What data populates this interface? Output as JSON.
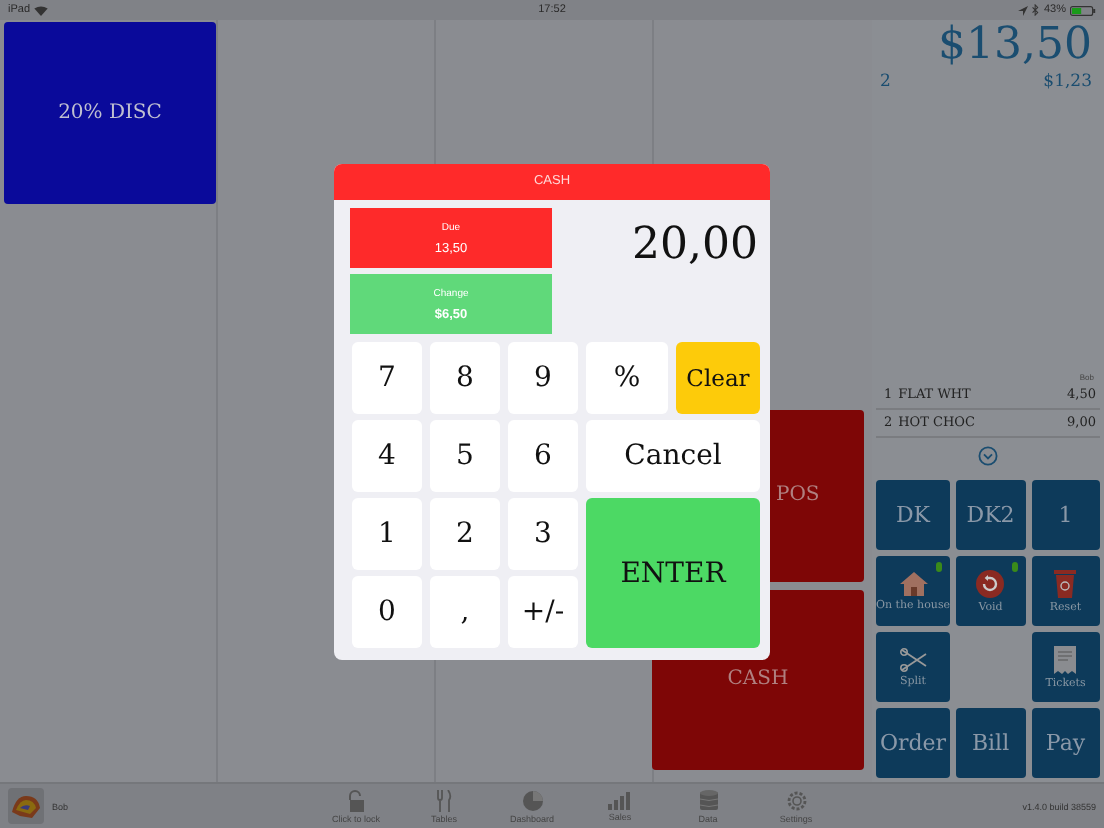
{
  "status_bar": {
    "device": "iPad",
    "time": "17:52",
    "battery": "43%"
  },
  "tiles": [
    {
      "label": "20% DISC",
      "color": "#0a0a9a"
    },
    {
      "label": "POS",
      "color": "#7e0606"
    },
    {
      "label": "CASH",
      "color": "#7e0606"
    }
  ],
  "order": {
    "total": "$13,50",
    "count": "2",
    "subtotal": "$1,23",
    "server": "Bob",
    "items": [
      {
        "qty": "1",
        "name": "FLAT WHT",
        "price": "4,50"
      },
      {
        "qty": "2",
        "name": "HOT CHOC",
        "price": "9,00"
      }
    ],
    "actions": [
      {
        "kind": "text",
        "label": "DK"
      },
      {
        "kind": "text",
        "label": "DK2"
      },
      {
        "kind": "text",
        "label": "1"
      },
      {
        "kind": "house",
        "label": "On the house",
        "badge": true
      },
      {
        "kind": "void",
        "label": "Void",
        "badge": true
      },
      {
        "kind": "trash",
        "label": "Reset",
        "badge": false
      },
      {
        "kind": "scissors",
        "label": "Split",
        "badge": false
      },
      {
        "kind": "blank"
      },
      {
        "kind": "receipt",
        "label": "Tickets",
        "badge": false
      },
      {
        "kind": "text",
        "label": "Order"
      },
      {
        "kind": "text",
        "label": "Bill"
      },
      {
        "kind": "text",
        "label": "Pay"
      }
    ]
  },
  "toolbar": {
    "user": "Bob",
    "items": [
      {
        "kind": "lock",
        "label": "Click to lock"
      },
      {
        "kind": "tables",
        "label": "Tables"
      },
      {
        "kind": "dashboard",
        "label": "Dashboard"
      },
      {
        "kind": "sales",
        "label": "Sales"
      },
      {
        "kind": "data",
        "label": "Data"
      },
      {
        "kind": "settings",
        "label": "Settings"
      }
    ],
    "version": "v1.4.0 build 38559"
  },
  "dialog": {
    "title": "CASH",
    "due": {
      "label": "Due",
      "value": "13,50"
    },
    "change": {
      "label": "Change",
      "value": "$6,50"
    },
    "display": "20,00",
    "keys": [
      {
        "kind": "key",
        "label": "7"
      },
      {
        "kind": "key",
        "label": "8"
      },
      {
        "kind": "key",
        "label": "9"
      },
      {
        "kind": "key",
        "label": "%"
      },
      {
        "kind": "clear",
        "label": "Clear"
      },
      {
        "kind": "key",
        "label": "4"
      },
      {
        "kind": "key",
        "label": "5"
      },
      {
        "kind": "key",
        "label": "6"
      },
      {
        "kind": "wide",
        "label": "Cancel"
      },
      {
        "kind": "key",
        "label": "1"
      },
      {
        "kind": "key",
        "label": "2"
      },
      {
        "kind": "key",
        "label": "3"
      },
      {
        "kind": "enter",
        "label": "ENTER"
      },
      {
        "kind": "key",
        "label": "0"
      },
      {
        "kind": "key",
        "label": ","
      },
      {
        "kind": "key",
        "label": "+/-"
      }
    ]
  }
}
